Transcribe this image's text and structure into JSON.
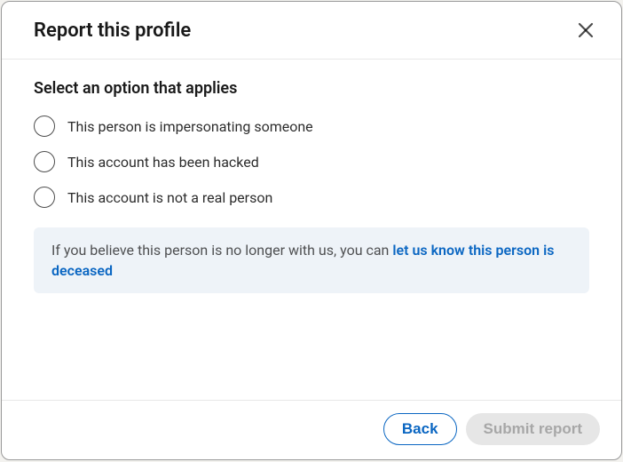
{
  "header": {
    "title": "Report this profile"
  },
  "body": {
    "instruction": "Select an option that applies",
    "options": [
      {
        "label": "This person is impersonating someone"
      },
      {
        "label": "This account has been hacked"
      },
      {
        "label": "This account is not a real person"
      }
    ],
    "info": {
      "prefix": "If you believe this person is no longer with us, you can ",
      "link_text": "let us know this person is deceased"
    }
  },
  "footer": {
    "back_label": "Back",
    "submit_label": "Submit report"
  }
}
